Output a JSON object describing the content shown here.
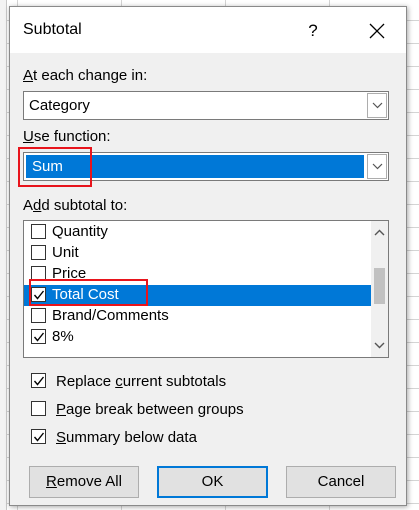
{
  "dialog": {
    "title": "Subtotal",
    "help_glyph": "?",
    "close_glyph": "✕"
  },
  "at_each_change": {
    "label_prefix": "",
    "label_accel": "A",
    "label_rest": "t each change in:",
    "value": "Category"
  },
  "use_function": {
    "label_prefix": "",
    "label_accel": "U",
    "label_rest": "se function:",
    "value": "Sum"
  },
  "add_subtotal": {
    "label_prefix": "A",
    "label_accel": "d",
    "label_rest": "d subtotal to:",
    "items": [
      {
        "label": "Quantity",
        "checked": false,
        "selected": false
      },
      {
        "label": "Unit",
        "checked": false,
        "selected": false
      },
      {
        "label": "Price",
        "checked": false,
        "selected": false
      },
      {
        "label": "Total Cost",
        "checked": true,
        "selected": true
      },
      {
        "label": "Brand/Comments",
        "checked": false,
        "selected": false
      },
      {
        "label": "8%",
        "checked": true,
        "selected": false
      }
    ]
  },
  "options": [
    {
      "prefix": "Replace ",
      "accel": "c",
      "rest": "urrent subtotals",
      "checked": true
    },
    {
      "prefix": "",
      "accel": "P",
      "rest": "age break between groups",
      "checked": false
    },
    {
      "prefix": "",
      "accel": "S",
      "rest": "ummary below data",
      "checked": true
    }
  ],
  "buttons": {
    "remove_all_accel": "R",
    "remove_all_rest": "emove All",
    "ok": "OK",
    "cancel": "Cancel"
  },
  "colors": {
    "selection": "#0078d7",
    "highlight": "#e8141c"
  }
}
